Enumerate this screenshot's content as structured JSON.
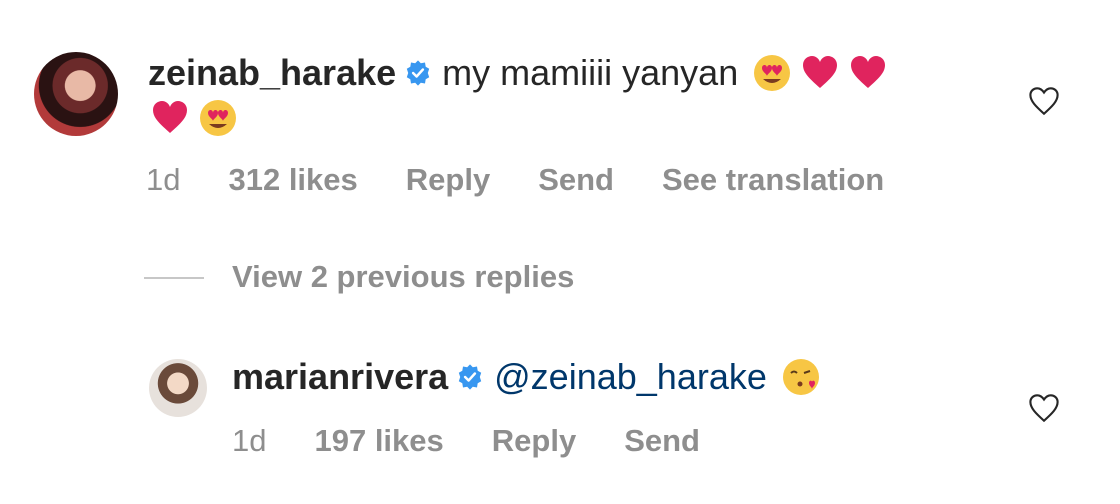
{
  "comments": [
    {
      "username": "zeinab_harake",
      "text": "my mamiiii yanyan",
      "emojis_line1": [
        "heart-eyes",
        "red-heart",
        "red-heart"
      ],
      "emojis_line2": [
        "red-heart",
        "heart-eyes"
      ],
      "time": "1d",
      "likes": "312 likes",
      "reply": "Reply",
      "send": "Send",
      "translate": "See translation"
    }
  ],
  "thread": {
    "view_replies": "View 2 previous replies"
  },
  "reply": {
    "username": "marianrivera",
    "mention": "@zeinab_harake",
    "emoji": "kissing-face",
    "time": "1d",
    "likes": "197 likes",
    "reply": "Reply",
    "send": "Send"
  },
  "colors": {
    "text": "#262626",
    "muted": "#8e8e8e",
    "mention": "#00376b",
    "verified": "#3897f0",
    "heart": "#e0245e"
  }
}
